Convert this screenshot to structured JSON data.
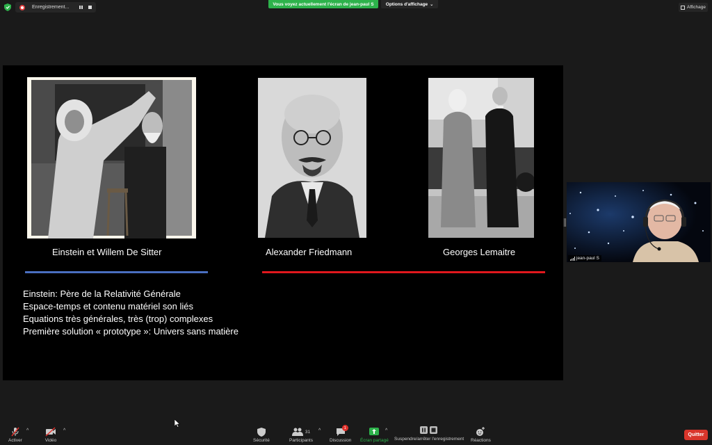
{
  "top_bar": {
    "recording_label": "Enregistrement...",
    "banner_text": "Vous voyez actuellement l'écran de jean-paul S",
    "view_options_label": "Options d'affichage",
    "view_label": "Affichage",
    "accent_green": "#2db24b"
  },
  "slide": {
    "photos": [
      {
        "caption": "Einstein et Willem De Sitter"
      },
      {
        "caption": "Alexander Friedmann"
      },
      {
        "caption": "Georges Lemaitre"
      }
    ],
    "divider_colors": {
      "left": "#4a6fc0",
      "right": "#e0171d"
    },
    "bullets": [
      "Einstein: Père de la Relativité Générale",
      "Espace-temps et contenu matériel son liés",
      "Equations très générales,  très (trop) complexes",
      "Première solution « prototype »: Univers sans matière"
    ]
  },
  "participant": {
    "name": "jean-paul S"
  },
  "toolbar": {
    "mute_label": "Activer",
    "video_label": "Vidéo",
    "security_label": "Sécurité",
    "participants_label": "Participants",
    "participants_count": "31",
    "chat_label": "Discussion",
    "chat_badge": "1",
    "share_label": "Écran partagé",
    "recording_label": "Suspendre/arrêter l'enregistrement",
    "reactions_label": "Réactions",
    "quit_label": "Quitter",
    "quit_color": "#d9352b"
  }
}
